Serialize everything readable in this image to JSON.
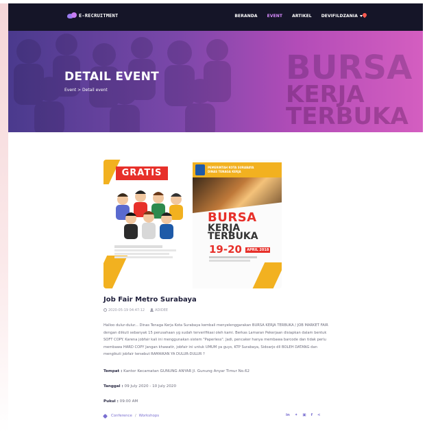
{
  "app": {
    "logo_text": "E-RECRUITMENT"
  },
  "nav": {
    "items": [
      {
        "label": "BERANDA",
        "active": false
      },
      {
        "label": "EVENT",
        "active": true
      },
      {
        "label": "ARTIKEL",
        "active": false
      },
      {
        "label": "DEVIFILDZANIA",
        "active": false,
        "dropdown": true
      }
    ]
  },
  "banner": {
    "title": "DETAIL EVENT",
    "breadcrumb": "Event > Detail event",
    "background_words": [
      "BURSA",
      "KERJA",
      "TERBUKA"
    ]
  },
  "poster": {
    "badge": "GRATIS",
    "gov_line1": "PEMERINTAH KOTA SURABAYA",
    "gov_line2": "DINAS TENAGA KERJA",
    "headline1": "BURSA",
    "headline2": "KERJA",
    "headline3": "TERBUKA",
    "dates": "19-20",
    "month_year": "APRIL 2018"
  },
  "event": {
    "title": "Job Fair Metro Surabaya",
    "timestamp": "2020-05-19 04:47:12",
    "author": "ADIDEE",
    "description": "Halloo dulur-dulur... Dinas Tenaga Kerja Kota Surabaya kembali menyelenggarakan BURSA KERJA TERBUKA / JOB MARKET FAIR dengan diikuti sebanyak 15 perusahaan yg sudah terverifikasi oleh kami. Berkas Lamaran Pekerjaan disiapkan dalam bentuk SOFT COPY. Karena jobfair kali ini menggunakan sistem \"Paperless\". Jadi, pencaker hanya membawa barcode dan tidak perlu membawa HARD COPY Jangan khawatir, jobfair ini untuk UMUM ya guys, KTP Surabaya, Sidoarjo dll BOLEH DATANG dan mengikuti jobfair tersebut RAMAIKAN YA DULUR-DULUR ?",
    "tempat_label": "Tempat :",
    "tempat_value": " Kantor Kecamatan GUNUNG ANYAR Jl. Gunung Anyar Timur No.62",
    "tanggal_label": "Tanggal :",
    "tanggal_value": " 09 July 2020 - 10 July 2020",
    "pukul_label": "Pukul :",
    "pukul_value": " 09:00 AM",
    "tags": [
      "Conference",
      "Workshops"
    ],
    "tag_separator": "/"
  },
  "share": {
    "icons": [
      "linkedin-icon",
      "twitter-icon",
      "instagram-icon",
      "facebook-icon",
      "share-icon"
    ],
    "glyphs": [
      "in",
      "✦",
      "▣",
      "f",
      "<"
    ]
  },
  "colors": {
    "navbar": "#151528",
    "accent": "#7a6fd1",
    "active_nav": "#d98cff",
    "poster_red": "#e7302a",
    "poster_yellow": "#f2b120"
  }
}
